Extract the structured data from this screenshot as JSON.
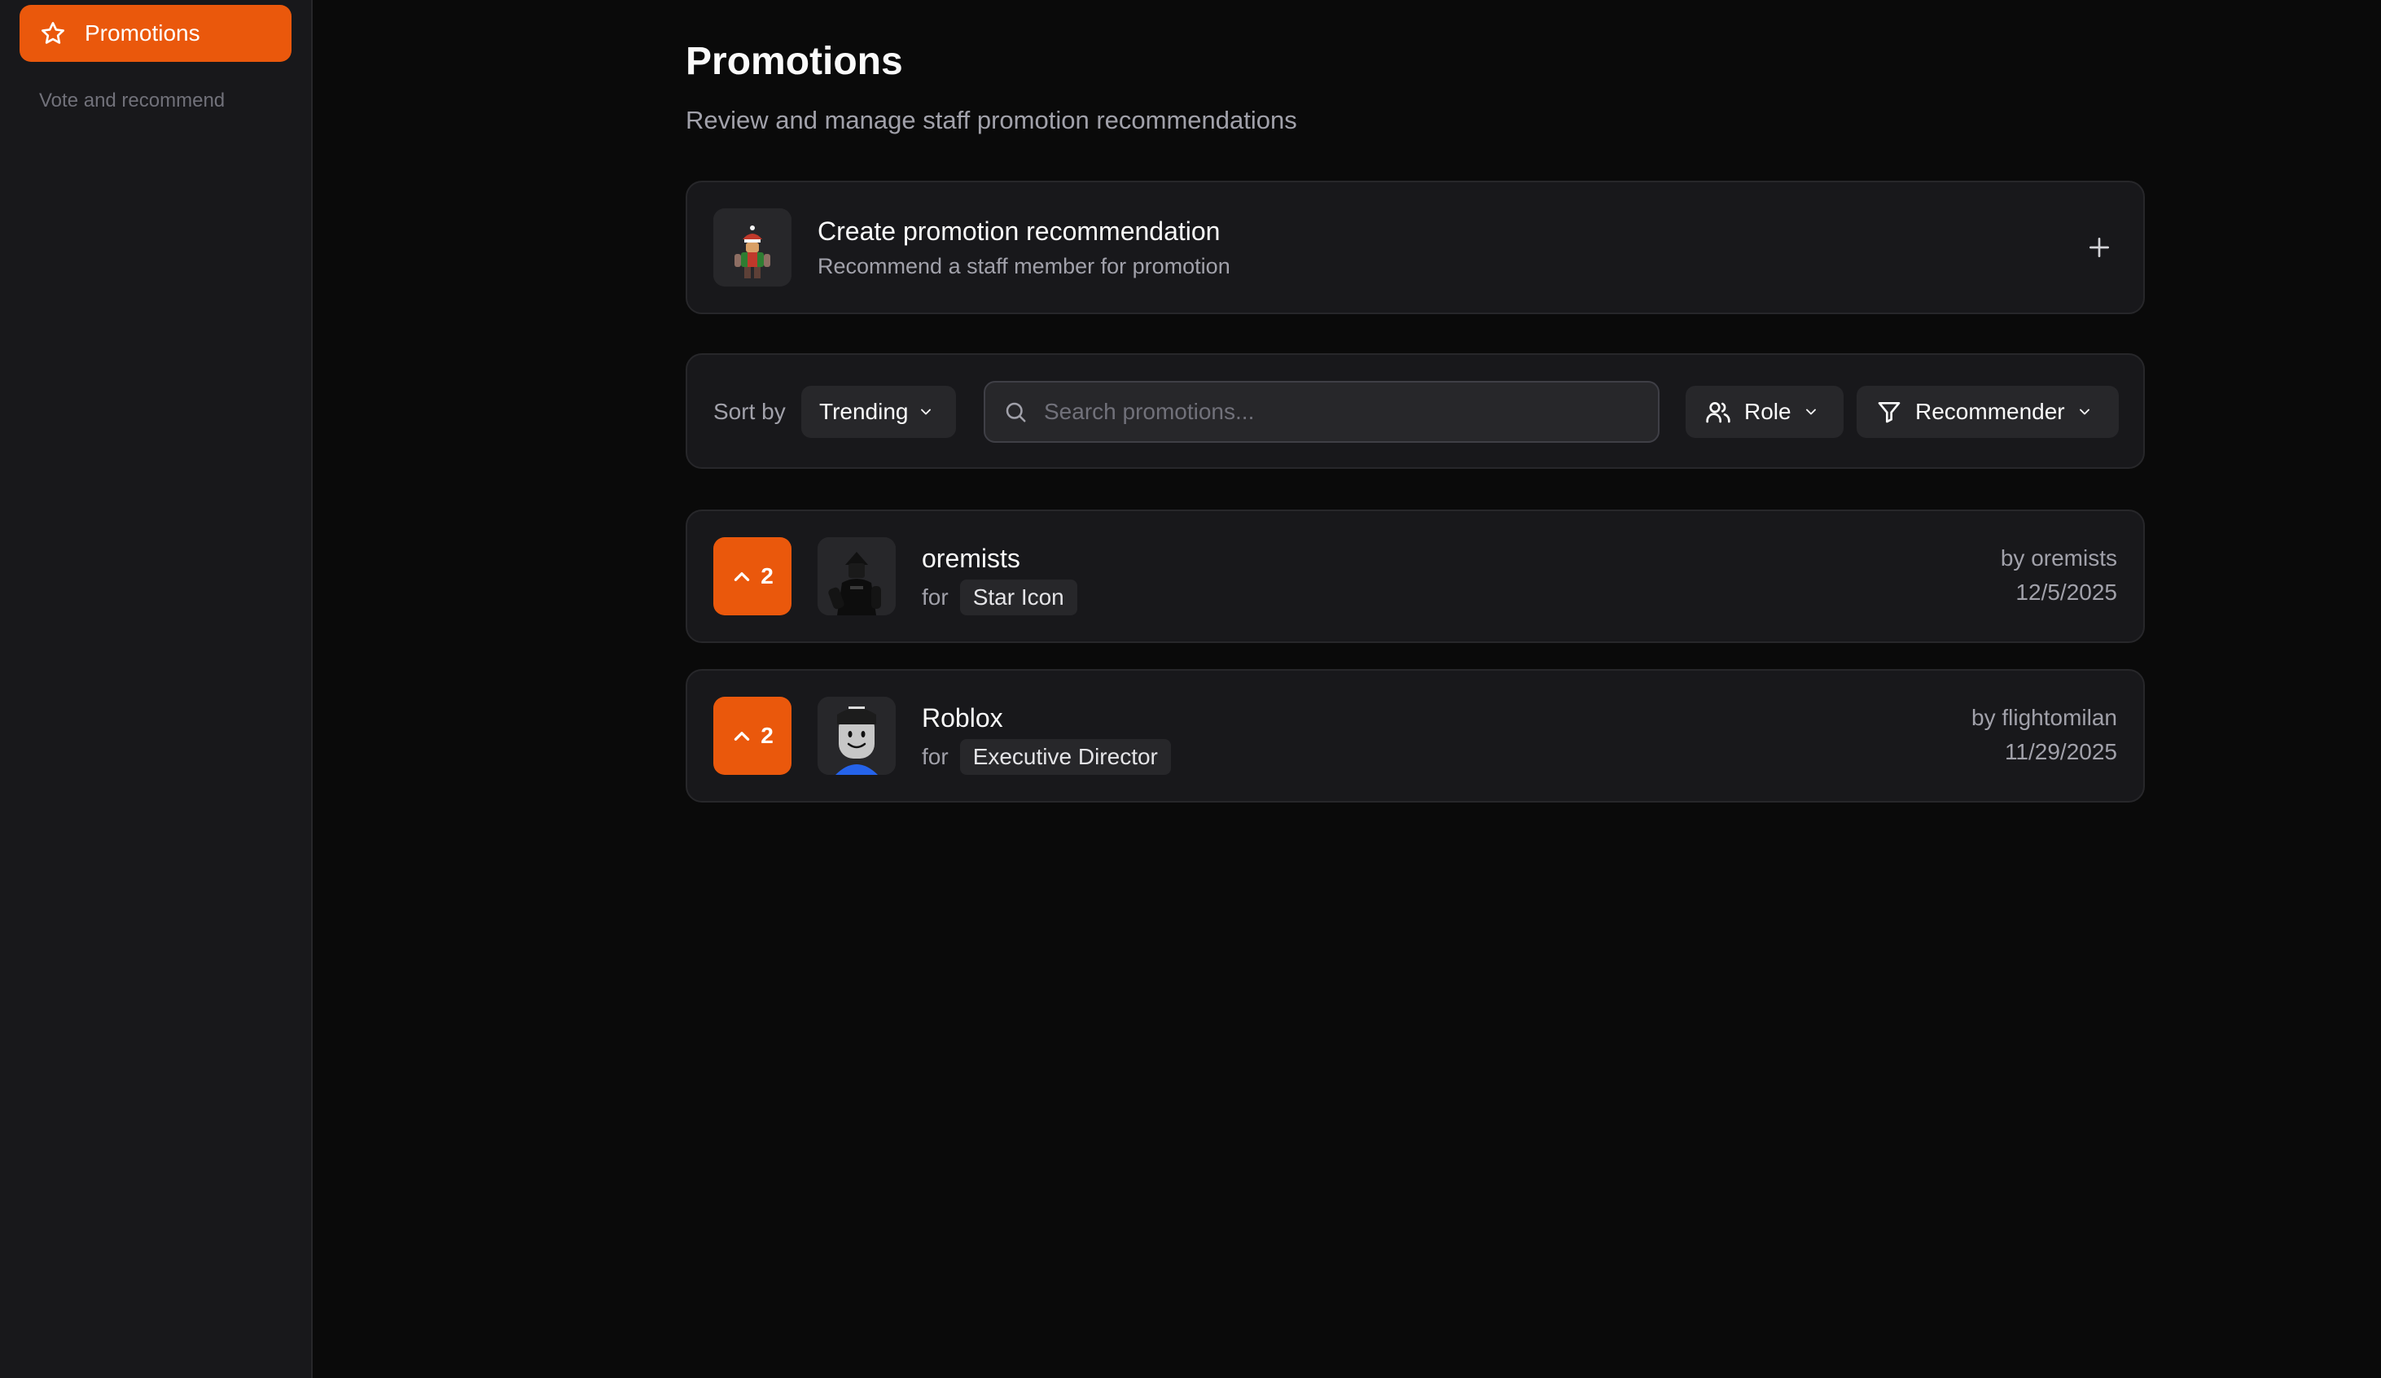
{
  "sidebar": {
    "active_item": {
      "label": "Promotions",
      "icon": "star-icon"
    },
    "caption": "Vote and recommend"
  },
  "header": {
    "title": "Promotions",
    "subtitle": "Review and manage staff promotion recommendations"
  },
  "create_card": {
    "title": "Create promotion recommendation",
    "description": "Recommend a staff member for promotion",
    "icon": "plus-icon"
  },
  "filters": {
    "sort_label": "Sort by",
    "sort_value": "Trending",
    "search_placeholder": "Search promotions...",
    "search_value": "",
    "role_label": "Role",
    "recommender_label": "Recommender"
  },
  "promotions": [
    {
      "votes": "2",
      "name": "oremists",
      "for_label": "for",
      "role": "Star Icon",
      "by": "by oremists",
      "date": "12/5/2025"
    },
    {
      "votes": "2",
      "name": "Roblox",
      "for_label": "for",
      "role": "Executive Director",
      "by": "by flightomilan",
      "date": "11/29/2025"
    }
  ],
  "colors": {
    "accent": "#ea580c",
    "background": "#0a0a0a",
    "card": "#18181b",
    "border": "#27272a",
    "muted_text": "#a1a1aa"
  }
}
